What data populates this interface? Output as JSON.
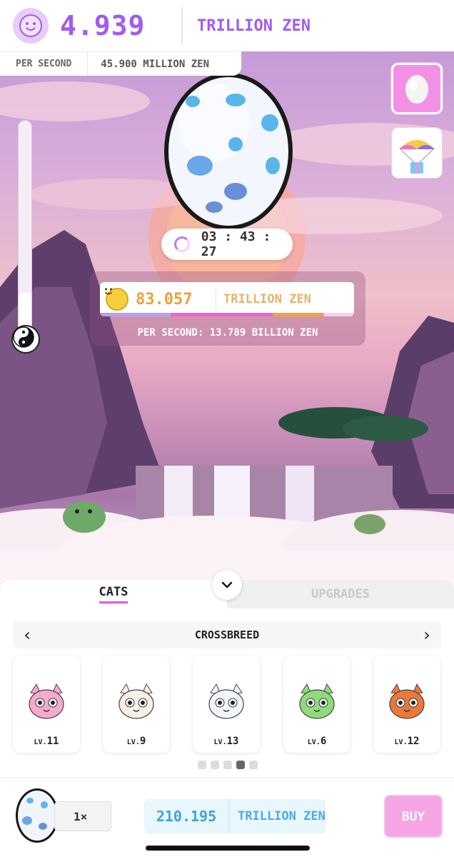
{
  "balance": {
    "amount": "4.939",
    "unit": "TRILLION ZEN"
  },
  "rate": {
    "label": "PER SECOND",
    "value": "45.900 MILLION ZEN"
  },
  "zen_meter": {
    "level": 0.25
  },
  "timer": {
    "value": "03 : 43 : 27"
  },
  "pool": {
    "amount": "83.057",
    "unit": "TRILLION ZEN",
    "per_second": "PER SECOND: 13.789 BILLION ZEN"
  },
  "tabs": [
    {
      "label": "CATS",
      "active": true
    },
    {
      "label": "UPGRADES",
      "active": false
    }
  ],
  "section": {
    "title": "CROSSBREED",
    "prev": "‹",
    "next": "›"
  },
  "cats": [
    {
      "lv_prefix": "LV.",
      "lv": "11",
      "color": "#f7a9d0"
    },
    {
      "lv_prefix": "LV.",
      "lv": "9",
      "color": "#f8efe6"
    },
    {
      "lv_prefix": "LV.",
      "lv": "13",
      "color": "#f2f6fb"
    },
    {
      "lv_prefix": "LV.",
      "lv": "6",
      "color": "#8fdc7c"
    },
    {
      "lv_prefix": "LV.",
      "lv": "12",
      "color": "#e9793a"
    }
  ],
  "pager": {
    "count": 5,
    "active": 4
  },
  "buy_bar": {
    "quantity": "1×",
    "price": "210.195",
    "unit": "TRILLION ZEN",
    "buy_label": "BUY"
  },
  "colors": {
    "accent": "#a05cf2",
    "pink": "#ef58c7",
    "gold": "#e9a23b",
    "blue": "#3fa3dc"
  }
}
